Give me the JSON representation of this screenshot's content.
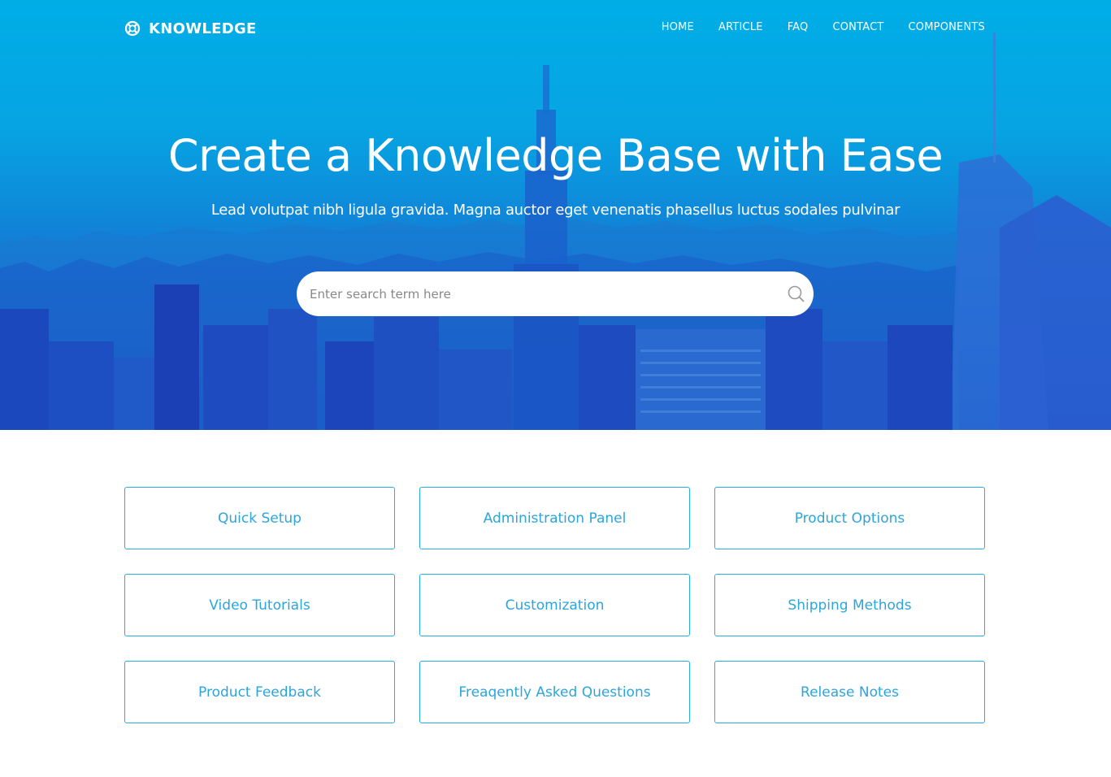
{
  "brand": {
    "name": "KNOWLEDGE",
    "icon": "lifebuoy-icon"
  },
  "nav": {
    "items": [
      {
        "label": "HOME"
      },
      {
        "label": "ARTICLE"
      },
      {
        "label": "FAQ"
      },
      {
        "label": "CONTACT"
      },
      {
        "label": "COMPONENTS"
      }
    ]
  },
  "hero": {
    "title": "Create a Knowledge Base with Ease",
    "subtitle": "Lead volutpat nibh ligula gravida. Magna auctor eget venenatis phasellus luctus sodales pulvinar"
  },
  "search": {
    "placeholder": "Enter search term here",
    "value": "",
    "icon": "search-icon"
  },
  "categories": [
    {
      "label": "Quick Setup"
    },
    {
      "label": "Administration Panel"
    },
    {
      "label": "Product Options"
    },
    {
      "label": "Video Tutorials"
    },
    {
      "label": "Customization"
    },
    {
      "label": "Shipping Methods"
    },
    {
      "label": "Product Feedback"
    },
    {
      "label": "Freaqently Asked Questions"
    },
    {
      "label": "Release Notes"
    }
  ],
  "colors": {
    "hero_top": "#00aee6",
    "hero_bottom": "#1a3fb8",
    "accent": "#25aee2",
    "card_text": "#2ca5dc"
  }
}
